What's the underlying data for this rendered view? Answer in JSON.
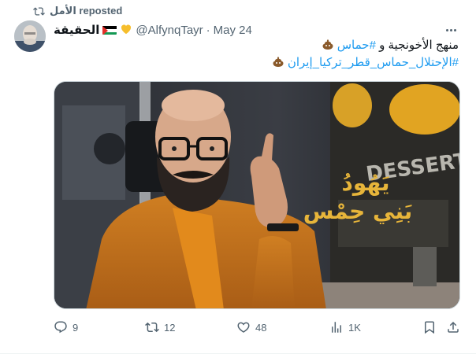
{
  "repost": {
    "label": "الأمل reposted"
  },
  "author": {
    "display_name": "الحقيقة",
    "handle": "@AlfynqTayr",
    "separator": "·",
    "date": "May 24"
  },
  "tweet": {
    "line1_text": "منهج الأخونجية و ",
    "line1_hashtag": "#حماس",
    "line2_hashtag": "#الإحتلال_حماس_قطر_تركيا_إيران"
  },
  "media": {
    "overlay_line1": "يَهُودُ",
    "overlay_line2": "بَنِي حِمْس",
    "sign_text": "DESSERTS"
  },
  "actions": {
    "replies": "9",
    "reposts": "12",
    "likes": "48",
    "views": "1K"
  },
  "colors": {
    "text_primary": "#0f1419",
    "text_secondary": "#536471",
    "link_blue": "#1d9bf0",
    "overlay_gold": "#e7b53a",
    "jacket_orange": "#c8741d"
  },
  "icons": [
    "repost-icon",
    "palestine-flag-icon",
    "yellow-heart-icon",
    "more-icon",
    "poo-emoji-icon",
    "reply-icon",
    "retweet-icon",
    "like-icon",
    "views-icon",
    "bookmark-icon",
    "share-icon"
  ]
}
